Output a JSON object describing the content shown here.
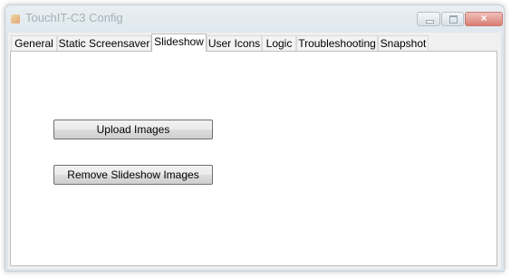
{
  "window": {
    "title": "TouchIT-C3 Config",
    "close_glyph": "×"
  },
  "tabs": [
    {
      "label": "General"
    },
    {
      "label": "Static Screensaver"
    },
    {
      "label": "Slideshow",
      "active": true
    },
    {
      "label": "User Icons"
    },
    {
      "label": "Logic"
    },
    {
      "label": "Troubleshooting"
    },
    {
      "label": "Snapshot"
    }
  ],
  "slideshow": {
    "upload_label": "Upload Images",
    "remove_label": "Remove Slideshow Images"
  },
  "icons": {
    "app": "app-icon",
    "minimize": "minimize-icon",
    "maximize": "maximize-icon",
    "close": "close-icon"
  }
}
